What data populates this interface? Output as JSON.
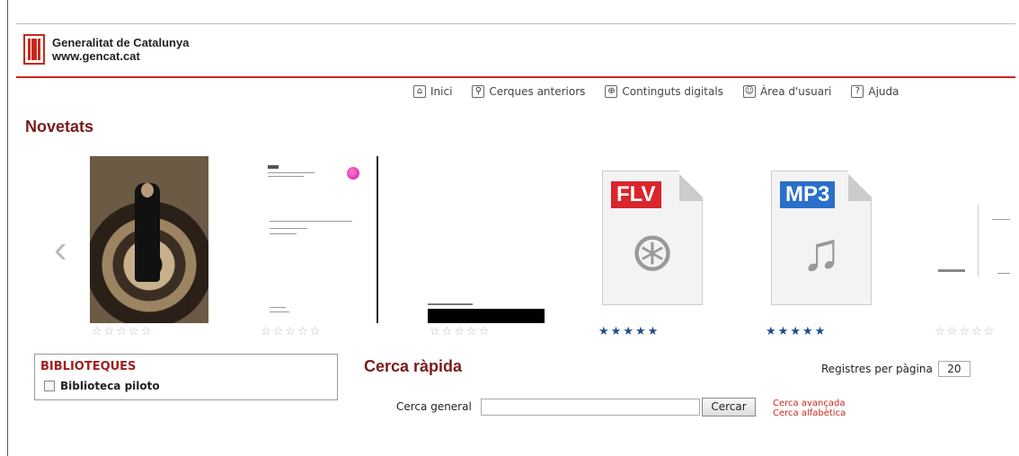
{
  "header": {
    "org_name": "Generalitat de Catalunya",
    "org_url": "www.gencat.cat"
  },
  "topnav": [
    {
      "label": "Inici",
      "icon": "home-icon"
    },
    {
      "label": "Cerques anteriors",
      "icon": "search-history-icon"
    },
    {
      "label": "Continguts digitals",
      "icon": "digital-content-icon"
    },
    {
      "label": "Àrea d'usuari",
      "icon": "user-icon"
    },
    {
      "label": "Ajuda",
      "icon": "help-icon"
    }
  ],
  "novetats": {
    "title": "Novetats",
    "items": [
      {
        "kind": "photo-cover",
        "rating": 0,
        "max_rating": 5
      },
      {
        "kind": "document-cover",
        "rating": 0,
        "max_rating": 5
      },
      {
        "kind": "document-cover",
        "rating": 0,
        "max_rating": 5
      },
      {
        "kind": "video-file",
        "label": "FLV",
        "rating": 5,
        "max_rating": 5
      },
      {
        "kind": "audio-file",
        "label": "MP3",
        "rating": 5,
        "max_rating": 5
      },
      {
        "kind": "document-cover",
        "rating": 0,
        "max_rating": 5
      }
    ]
  },
  "libraries": {
    "title": "BIBLIOTEQUES",
    "items": [
      {
        "label": "Biblioteca piloto",
        "checked": false
      }
    ]
  },
  "quick_search": {
    "title": "Cerca ràpida",
    "per_page_label": "Registres per pàgina",
    "per_page_value": "20",
    "general_label": "Cerca general",
    "general_value": "",
    "button_label": "Cercar",
    "advanced_link": "Cerca avançada",
    "alphabetic_link": "Cerca alfabètica"
  },
  "colors": {
    "brand_red": "#c8281c",
    "title_maroon": "#7a1c1c",
    "star_active": "#1f4e8c",
    "flv_label": "#d9262c",
    "mp3_label": "#2a6fc9"
  }
}
